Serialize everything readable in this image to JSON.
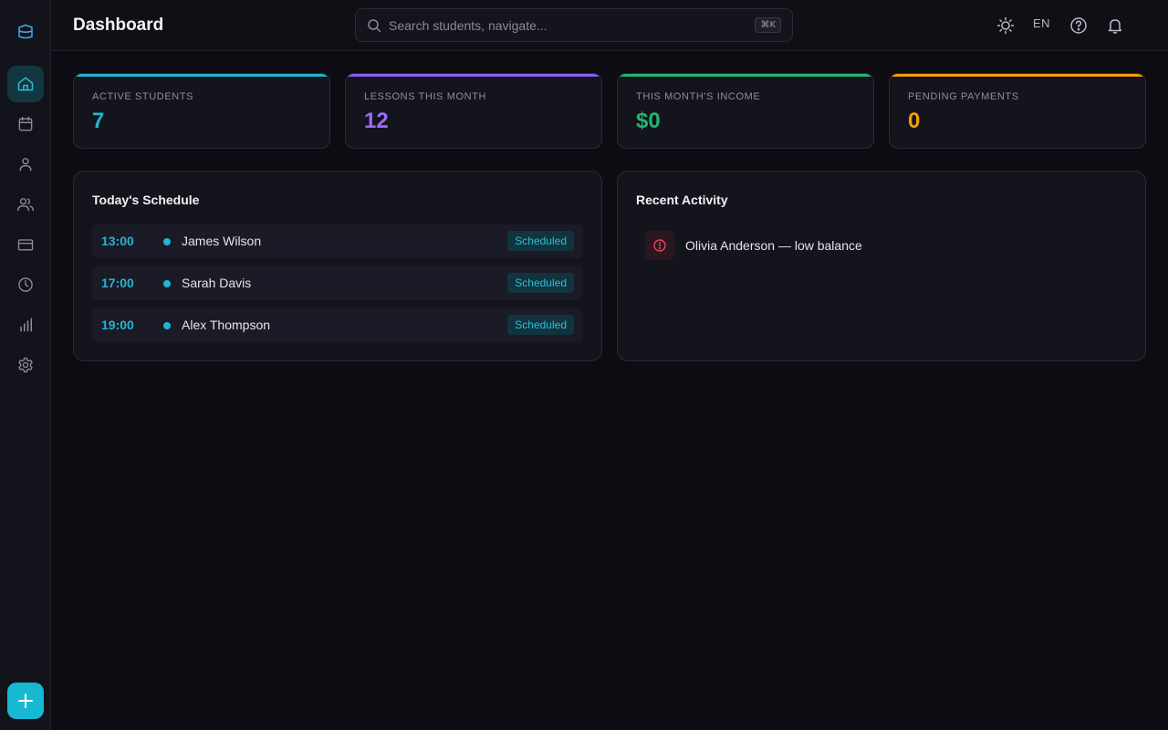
{
  "header": {
    "title": "Dashboard",
    "search_placeholder": "Search students, navigate...",
    "search_shortcut": "⌘K",
    "language": "EN"
  },
  "sidebar": {
    "items": [
      {
        "id": "home",
        "icon": "home-icon",
        "active": true
      },
      {
        "id": "calendar",
        "icon": "calendar-icon",
        "active": false
      },
      {
        "id": "student",
        "icon": "user-icon",
        "active": false
      },
      {
        "id": "students",
        "icon": "users-icon",
        "active": false
      },
      {
        "id": "payments",
        "icon": "credit-card-icon",
        "active": false
      },
      {
        "id": "history",
        "icon": "clock-icon",
        "active": false
      },
      {
        "id": "reports",
        "icon": "bar-chart-icon",
        "active": false
      },
      {
        "id": "settings",
        "icon": "gear-icon",
        "active": false
      }
    ],
    "add_label": "+"
  },
  "stats": [
    {
      "label": "ACTIVE STUDENTS",
      "value": "7",
      "color": "#1eb6d3"
    },
    {
      "label": "LESSONS THIS MONTH",
      "value": "12",
      "color": "#8b5cf6"
    },
    {
      "label": "THIS MONTH'S INCOME",
      "value": "$0",
      "color": "#22b573"
    },
    {
      "label": "PENDING PAYMENTS",
      "value": "0",
      "color": "#f59e0b"
    }
  ],
  "schedule": {
    "title": "Today's Schedule",
    "rows": [
      {
        "time": "13:00",
        "name": "James Wilson",
        "status": "Scheduled"
      },
      {
        "time": "17:00",
        "name": "Sarah Davis",
        "status": "Scheduled"
      },
      {
        "time": "19:00",
        "name": "Alex Thompson",
        "status": "Scheduled"
      }
    ]
  },
  "activity": {
    "title": "Recent Activity",
    "items": [
      {
        "icon": "alert-circle-icon",
        "text": "Olivia Anderson — low balance",
        "color": "#e0475f"
      }
    ]
  }
}
